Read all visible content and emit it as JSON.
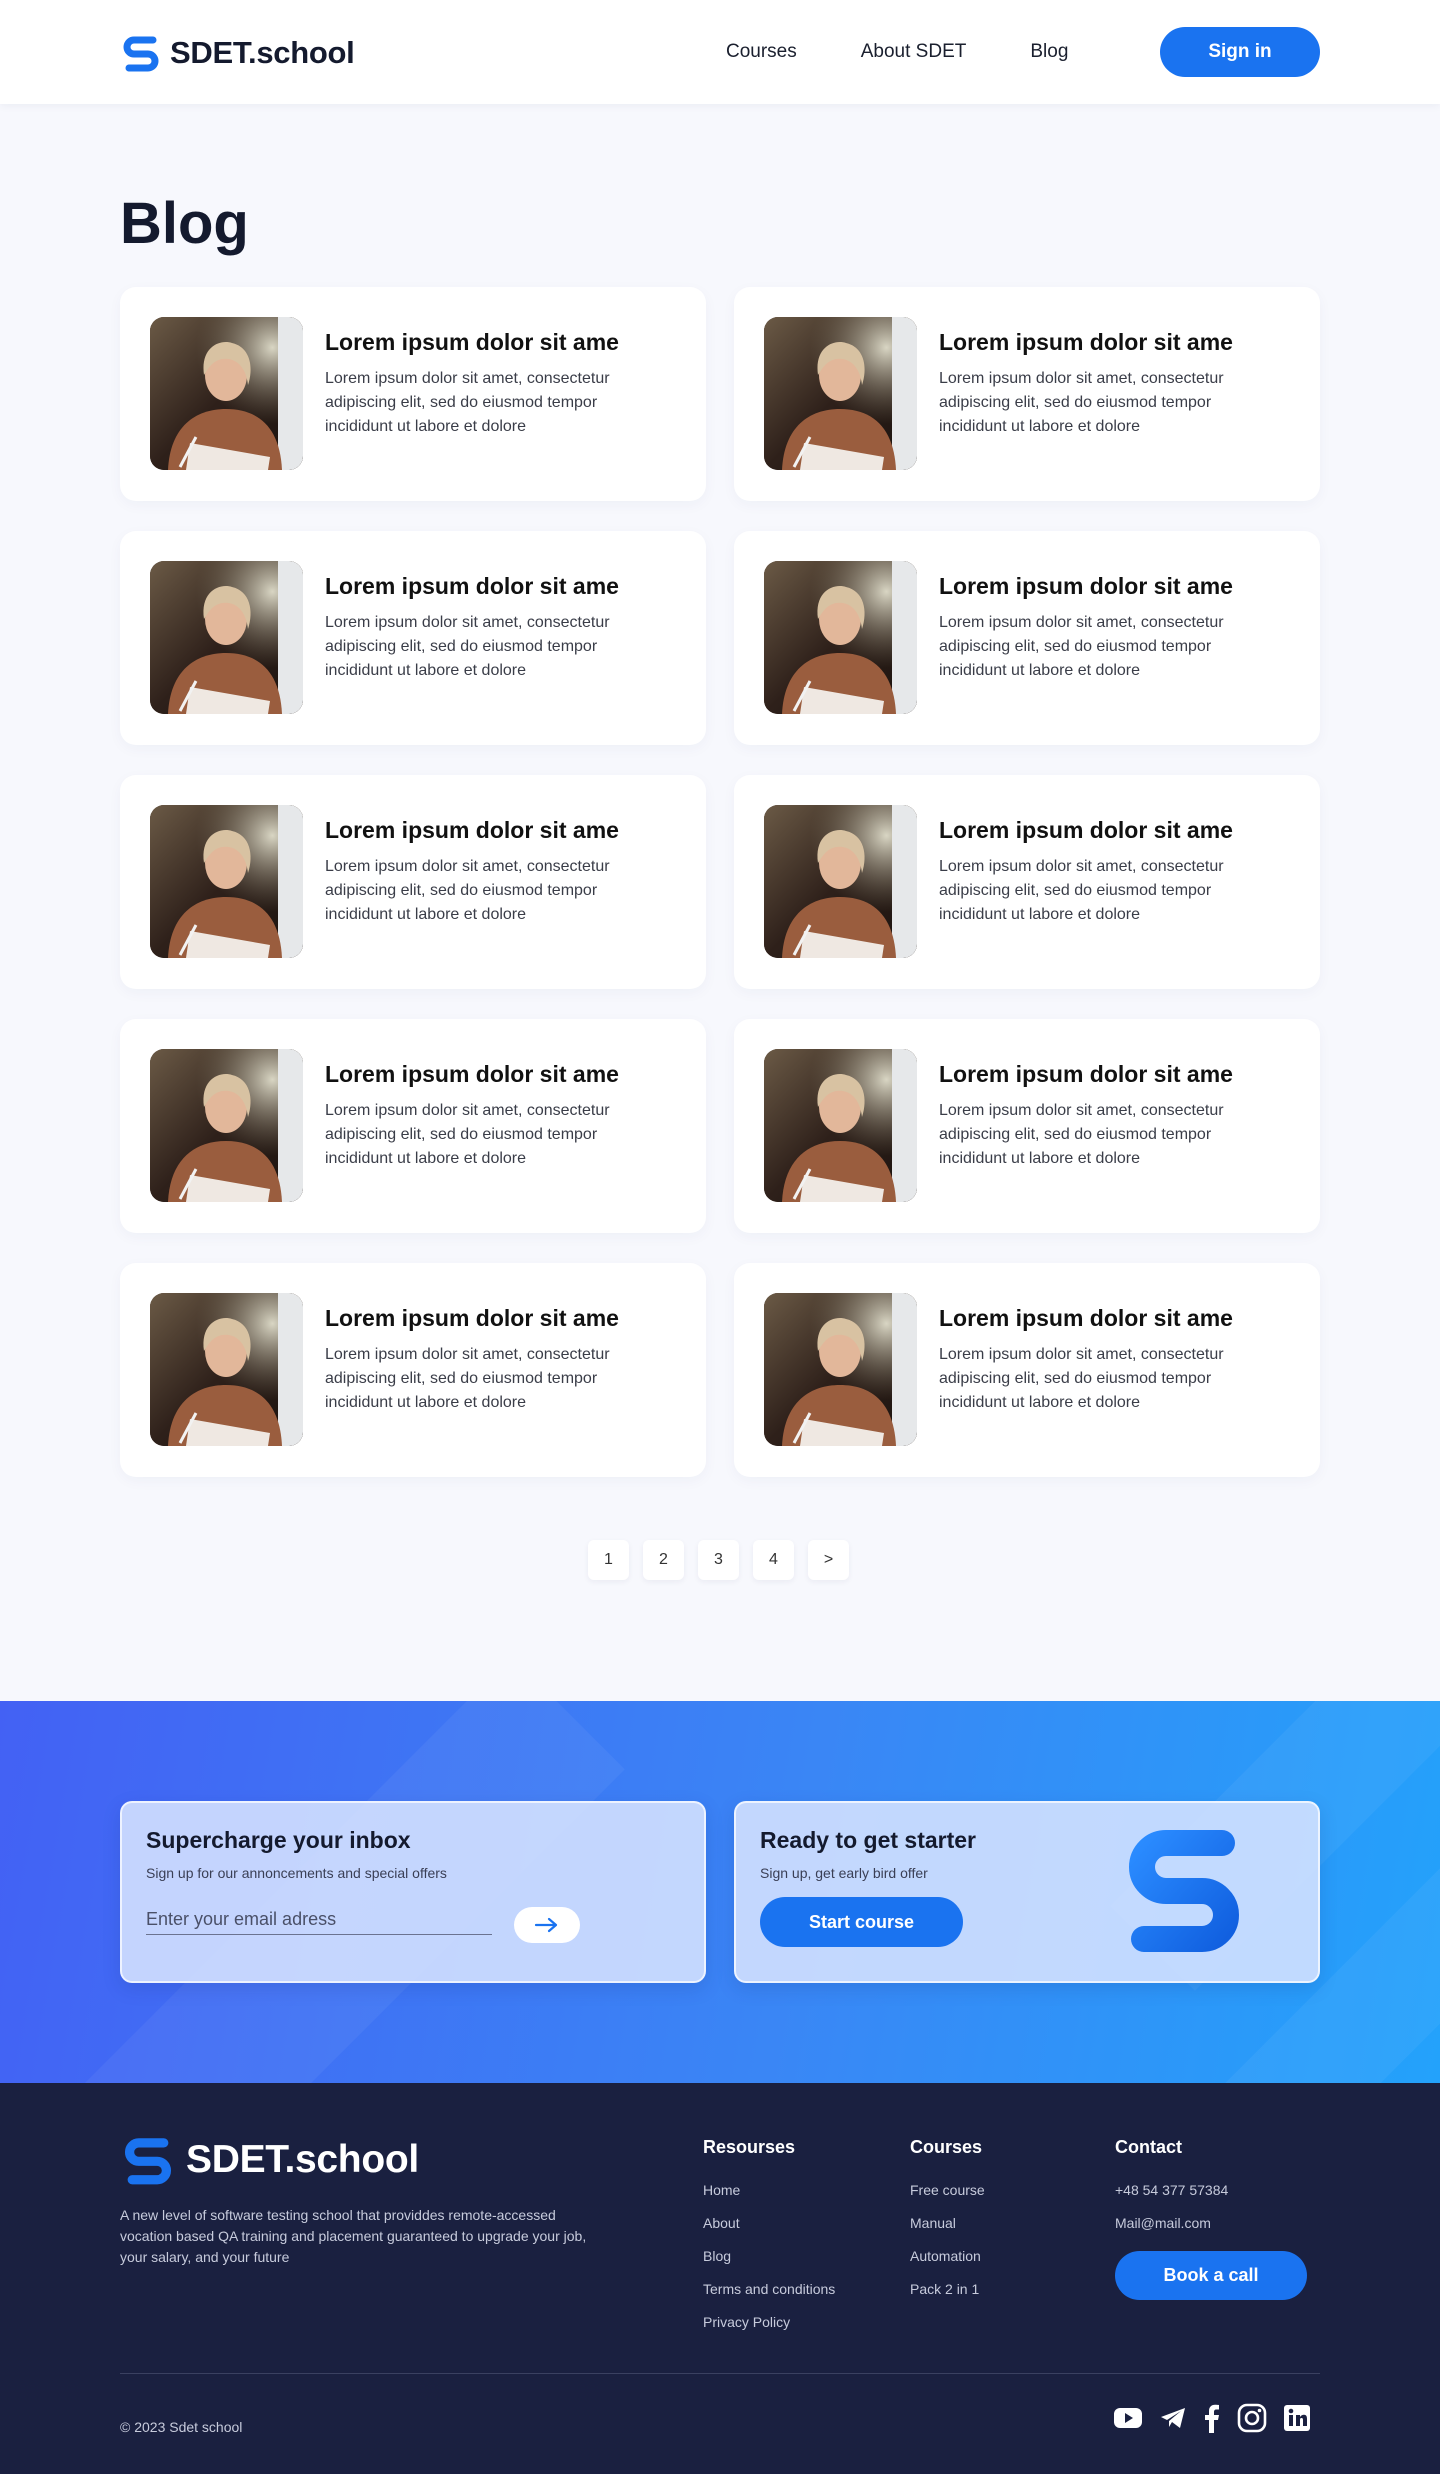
{
  "header": {
    "logo_text": "SDET.school",
    "nav": [
      "Courses",
      "About SDET",
      "Blog"
    ],
    "signin_label": "Sign in"
  },
  "page_title": "Blog",
  "posts": [
    {
      "title": "Lorem ipsum dolor sit ame",
      "text": "Lorem ipsum dolor sit amet, consectetur adipiscing elit, sed do eiusmod tempor incididunt ut labore et dolore"
    },
    {
      "title": "Lorem ipsum dolor sit ame",
      "text": "Lorem ipsum dolor sit amet, consectetur adipiscing elit, sed do eiusmod tempor incididunt ut labore et dolore"
    },
    {
      "title": "Lorem ipsum dolor sit ame",
      "text": "Lorem ipsum dolor sit amet, consectetur adipiscing elit, sed do eiusmod tempor incididunt ut labore et dolore"
    },
    {
      "title": "Lorem ipsum dolor sit ame",
      "text": "Lorem ipsum dolor sit amet, consectetur adipiscing elit, sed do eiusmod tempor incididunt ut labore et dolore"
    },
    {
      "title": "Lorem ipsum dolor sit ame",
      "text": "Lorem ipsum dolor sit amet, consectetur adipiscing elit, sed do eiusmod tempor incididunt ut labore et dolore"
    },
    {
      "title": "Lorem ipsum dolor sit ame",
      "text": "Lorem ipsum dolor sit amet, consectetur adipiscing elit, sed do eiusmod tempor incididunt ut labore et dolore"
    },
    {
      "title": "Lorem ipsum dolor sit ame",
      "text": "Lorem ipsum dolor sit amet, consectetur adipiscing elit, sed do eiusmod tempor incididunt ut labore et dolore"
    },
    {
      "title": "Lorem ipsum dolor sit ame",
      "text": "Lorem ipsum dolor sit amet, consectetur adipiscing elit, sed do eiusmod tempor incididunt ut labore et dolore"
    },
    {
      "title": "Lorem ipsum dolor sit ame",
      "text": "Lorem ipsum dolor sit amet, consectetur adipiscing elit, sed do eiusmod tempor incididunt ut labore et dolore"
    },
    {
      "title": "Lorem ipsum dolor sit ame",
      "text": "Lorem ipsum dolor sit amet, consectetur adipiscing elit, sed do eiusmod tempor incididunt ut labore et dolore"
    }
  ],
  "pagination": [
    "1",
    "2",
    "3",
    "4",
    ">"
  ],
  "newsletter": {
    "title": "Supercharge your inbox",
    "subtitle": "Sign up for our annoncements and special offers",
    "email_placeholder": "Enter your email adress"
  },
  "starter": {
    "title": "Ready to get starter",
    "subtitle": "Sign up, get early bird offer",
    "button_label": "Start course"
  },
  "footer": {
    "logo_text": "SDET.school",
    "description": "A new level of software testing school that providdes remote-accessed vocation based QA training and placement guaranteed to upgrade your job, your salary, and your future",
    "resources": {
      "title": "Resourses",
      "links": [
        "Home",
        "About",
        "Blog",
        "Terms and conditions",
        "Privacy Policy"
      ]
    },
    "courses": {
      "title": "Courses",
      "links": [
        "Free course",
        "Manual",
        "Automation",
        "Pack 2 in 1"
      ]
    },
    "contact": {
      "title": "Contact",
      "phone": "+48 54 377 57384",
      "email": "Mail@mail.com",
      "button_label": "Book a call"
    },
    "copyright": "© 2023 Sdet school",
    "social_icons": [
      "youtube-icon",
      "telegram-icon",
      "facebook-icon",
      "instagram-icon",
      "linkedin-icon"
    ]
  },
  "colors": {
    "accent": "#1a73f0",
    "footer_bg": "#1a2040",
    "page_bg": "#f7f8fd"
  }
}
